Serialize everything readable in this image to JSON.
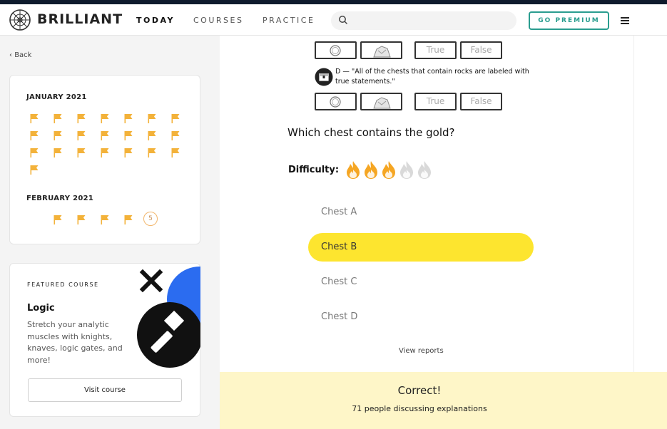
{
  "header": {
    "brand": "BRILLIANT",
    "nav": [
      {
        "label": "TODAY",
        "active": true
      },
      {
        "label": "COURSES",
        "active": false
      },
      {
        "label": "PRACTICE",
        "active": false
      }
    ],
    "search_placeholder": "",
    "premium_label": "GO PREMIUM"
  },
  "sidebar": {
    "back_label": "Back",
    "calendar": {
      "months": [
        {
          "name": "JANUARY 2021",
          "flags": 22
        },
        {
          "name": "FEBRUARY 2021",
          "flags": 4,
          "current_day": "5"
        }
      ]
    },
    "featured": {
      "label": "FEATURED COURSE",
      "title": "Logic",
      "description": "Stretch your analytic muscles with knights, knaves, logic gates, and more!",
      "button_label": "Visit course"
    }
  },
  "puzzle": {
    "rows": [
      {
        "true_label": "True",
        "false_label": "False"
      },
      {
        "true_label": "True",
        "false_label": "False"
      }
    ],
    "statement_d": "D — \"All of the chests that contain rocks are labeled with true statements.\"",
    "question": "Which chest contains the gold?",
    "difficulty_label": "Difficulty:",
    "difficulty_level": 3,
    "difficulty_max": 5,
    "choices": [
      {
        "label": "Chest A",
        "selected": false
      },
      {
        "label": "Chest B",
        "selected": true
      },
      {
        "label": "Chest C",
        "selected": false
      },
      {
        "label": "Chest D",
        "selected": false
      }
    ],
    "view_reports": "View reports"
  },
  "result": {
    "status": "Correct!",
    "discussion": "71 people discussing explanations"
  },
  "colors": {
    "accent": "#2a9d8f",
    "flag": "#f3b23a",
    "selected": "#fde52f",
    "flame_active": "#f5a623",
    "flame_inactive": "#d9d9d9",
    "result_bg": "#fef6c8"
  }
}
